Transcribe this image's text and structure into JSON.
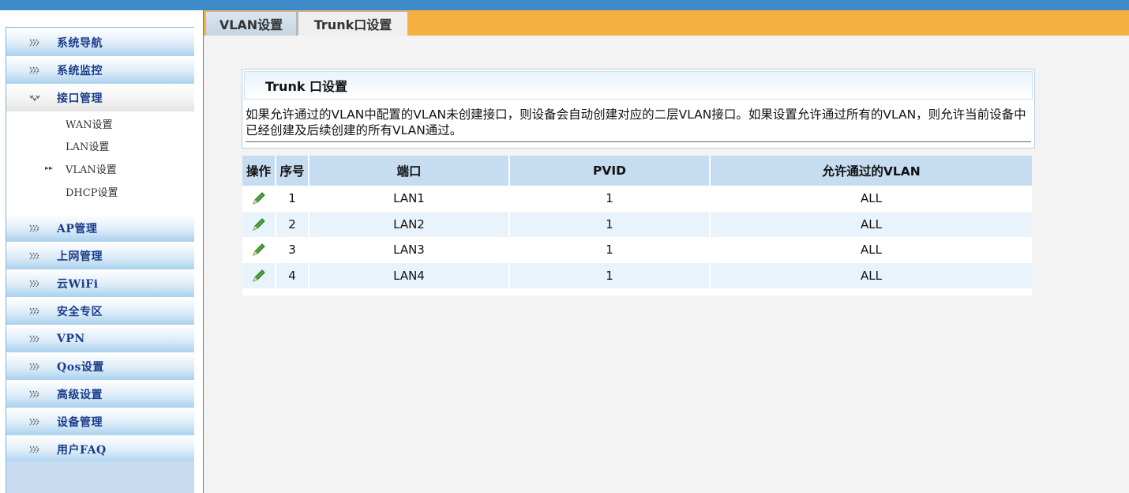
{
  "sidebar": {
    "items": [
      {
        "label": "系统导航",
        "icon": "triple-chevron-right-icon"
      },
      {
        "label": "系统监控",
        "icon": "triple-chevron-right-icon"
      },
      {
        "label": "接口管理",
        "icon": "triple-chevron-down-icon",
        "expanded": true
      },
      {
        "label": "AP管理",
        "icon": "triple-chevron-right-icon"
      },
      {
        "label": "上网管理",
        "icon": "triple-chevron-right-icon"
      },
      {
        "label": "云WiFi",
        "icon": "triple-chevron-right-icon"
      },
      {
        "label": "安全专区",
        "icon": "triple-chevron-right-icon"
      },
      {
        "label": "VPN",
        "icon": "triple-chevron-right-icon"
      },
      {
        "label": "Qos设置",
        "icon": "triple-chevron-right-icon"
      },
      {
        "label": "高级设置",
        "icon": "triple-chevron-right-icon"
      },
      {
        "label": "设备管理",
        "icon": "triple-chevron-right-icon"
      },
      {
        "label": "用户FAQ",
        "icon": "triple-chevron-right-icon"
      }
    ],
    "subitems": [
      {
        "label": "WAN设置",
        "selected": false
      },
      {
        "label": "LAN设置",
        "selected": false
      },
      {
        "label": "VLAN设置",
        "selected": true
      },
      {
        "label": "DHCP设置",
        "selected": false
      }
    ]
  },
  "tabs": [
    {
      "label": "VLAN设置",
      "active": false
    },
    {
      "label": "Trunk口设置",
      "active": true
    }
  ],
  "panel": {
    "title": "Trunk 口设置",
    "description": "如果允许通过的VLAN中配置的VLAN未创建接口，则设备会自动创建对应的二层VLAN接口。如果设置允许通过所有的VLAN，则允许当前设备中已经创建及后续创建的所有VLAN通过。"
  },
  "table": {
    "headers": [
      "操作",
      "序号",
      "端口",
      "PVID",
      "允许通过的VLAN"
    ],
    "rows": [
      {
        "index": "1",
        "port": "LAN1",
        "pvid": "1",
        "vlan": "ALL"
      },
      {
        "index": "2",
        "port": "LAN2",
        "pvid": "1",
        "vlan": "ALL"
      },
      {
        "index": "3",
        "port": "LAN3",
        "pvid": "1",
        "vlan": "ALL"
      },
      {
        "index": "4",
        "port": "LAN4",
        "pvid": "1",
        "vlan": "ALL"
      }
    ],
    "edit_icon": "pencil-edit-icon"
  },
  "colors": {
    "topbar": "#3f8ac8",
    "tabbar": "#f5b040",
    "header_row": "#c6dcf0",
    "alt_row": "#e9f3fc",
    "nav_text": "#1a3d8a"
  }
}
